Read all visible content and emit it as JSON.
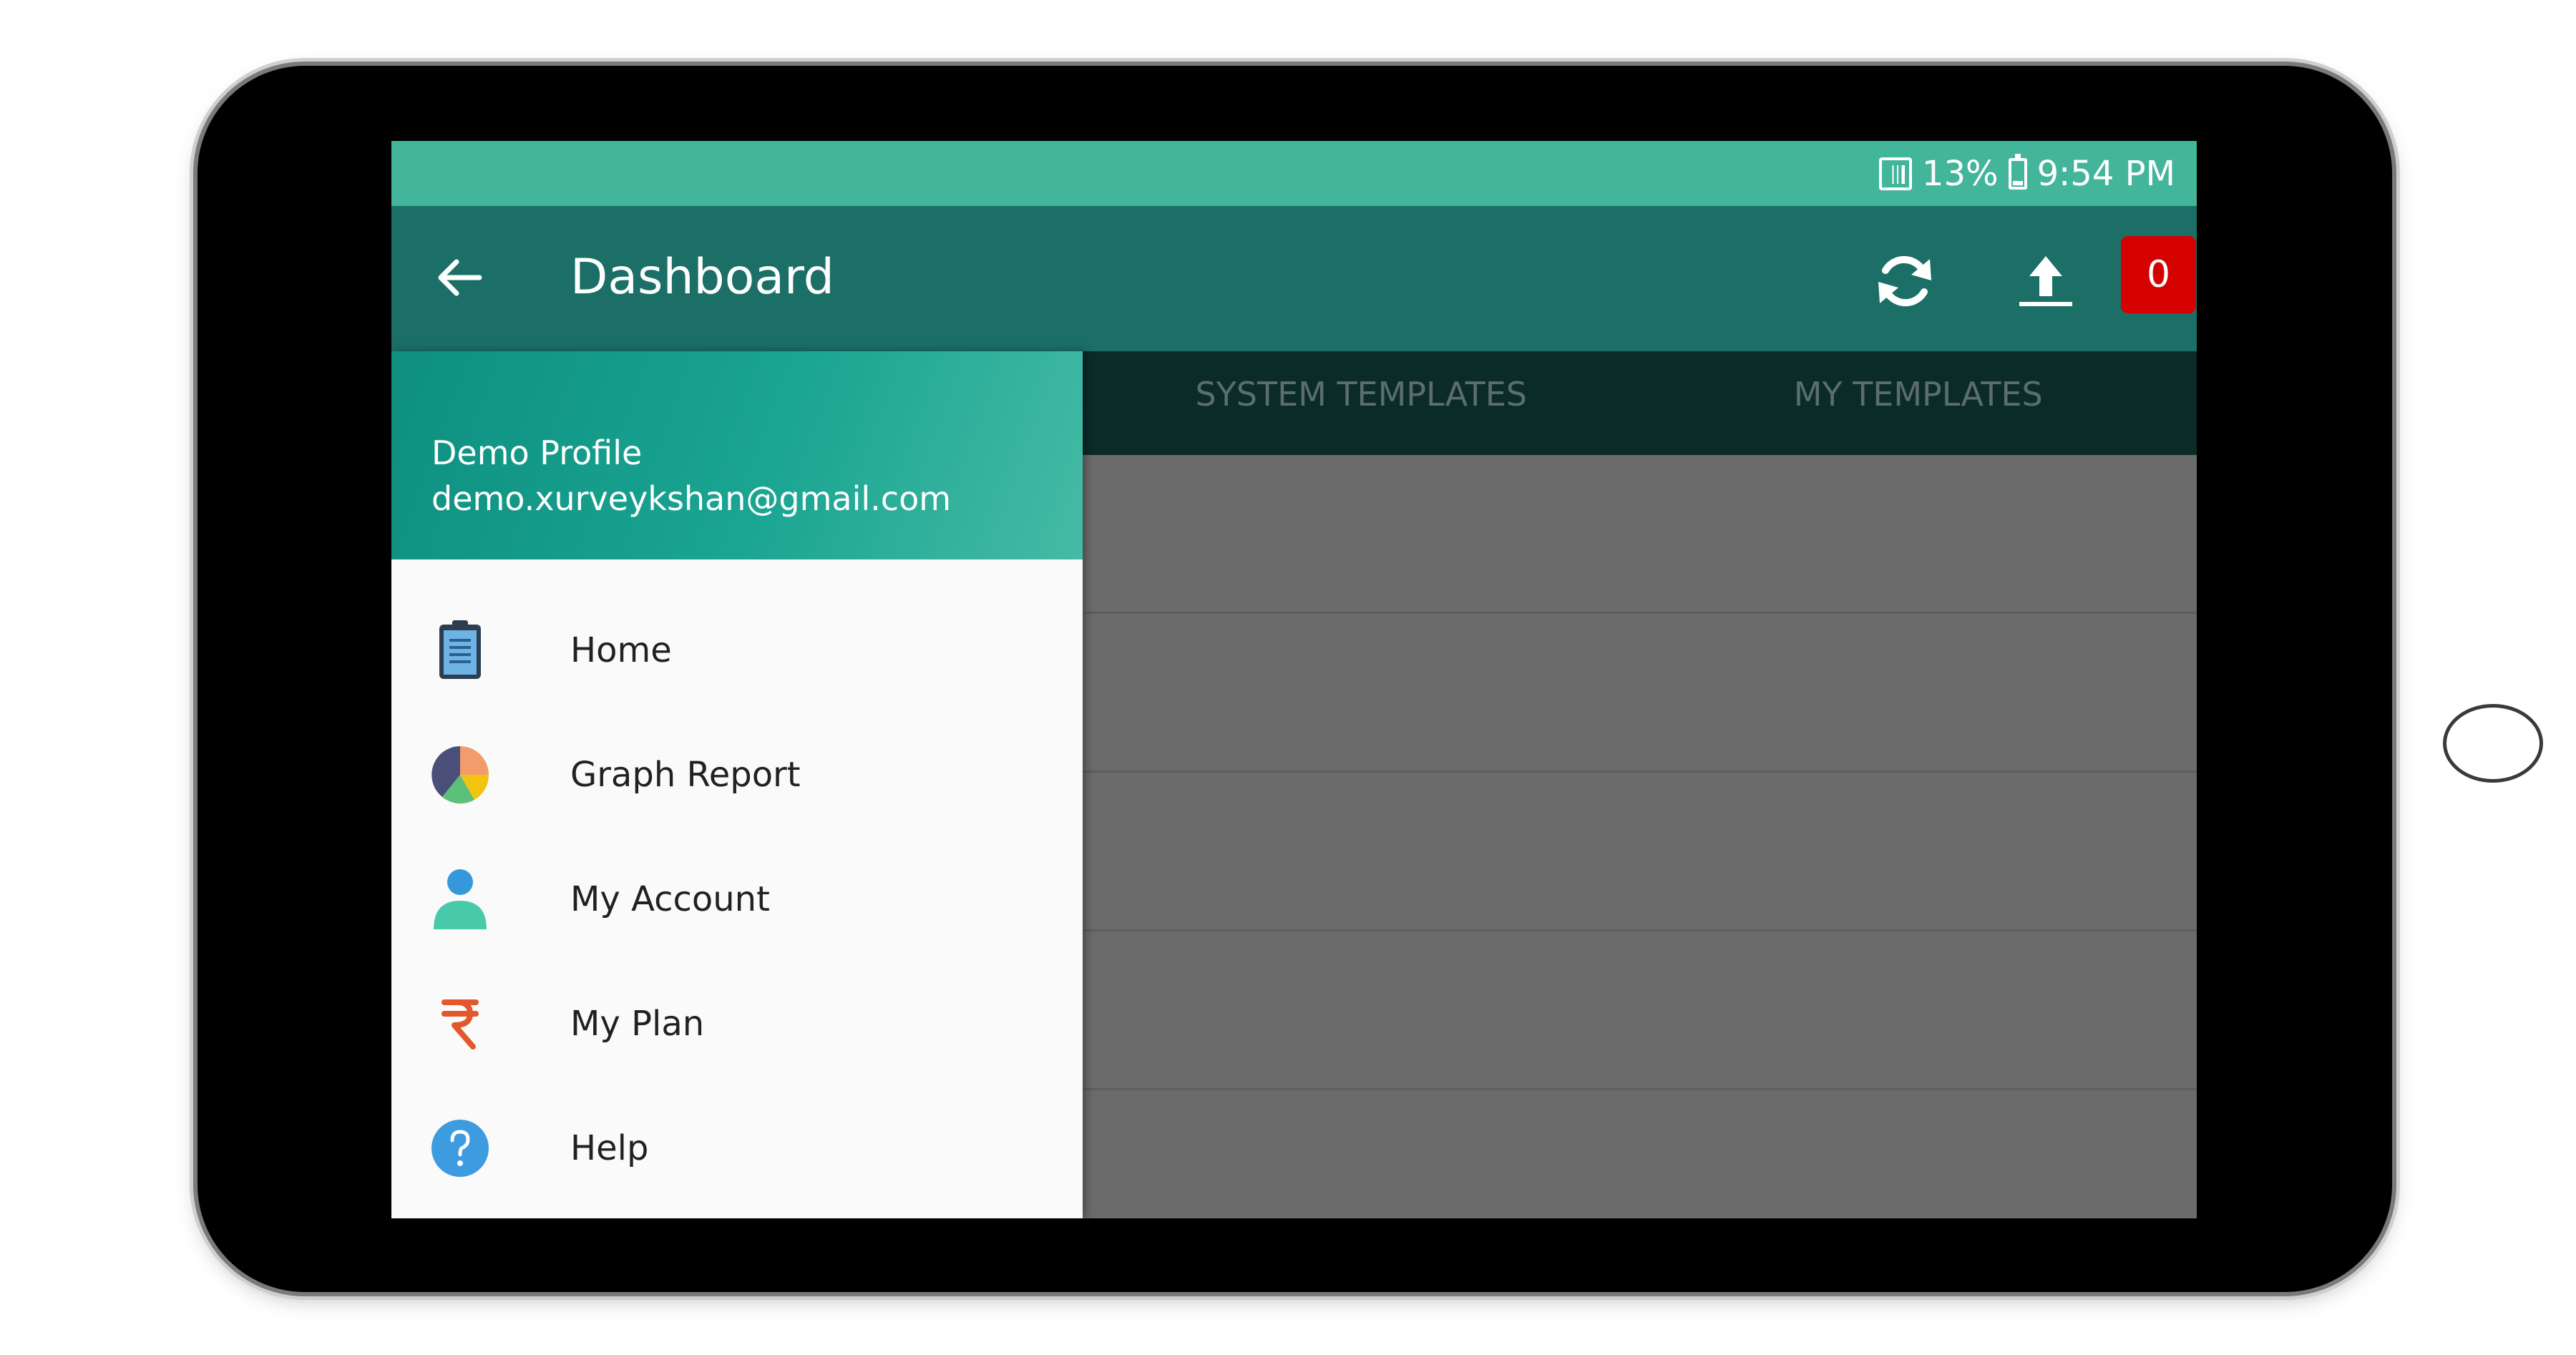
{
  "status_bar": {
    "battery": "13%",
    "time": "9:54 PM"
  },
  "app_bar": {
    "title": "Dashboard",
    "notification_count": "0"
  },
  "tabs": [
    {
      "label": "SYSTEM TEMPLATES"
    },
    {
      "label": "MY TEMPLATES"
    }
  ],
  "drawer": {
    "profile_name": "Demo Profile",
    "profile_email": "demo.xurveykshan@gmail.com",
    "items": [
      {
        "label": "Home",
        "icon": "clipboard-icon"
      },
      {
        "label": "Graph Report",
        "icon": "pie-chart-icon"
      },
      {
        "label": "My Account",
        "icon": "user-icon"
      },
      {
        "label": "My Plan",
        "icon": "rupee-icon"
      },
      {
        "label": "Help",
        "icon": "help-icon"
      }
    ]
  },
  "colors": {
    "status_bar": "#42b59a",
    "app_bar": "#1b6f67",
    "tabs_bg": "#0b2b28",
    "badge": "#d50000"
  }
}
